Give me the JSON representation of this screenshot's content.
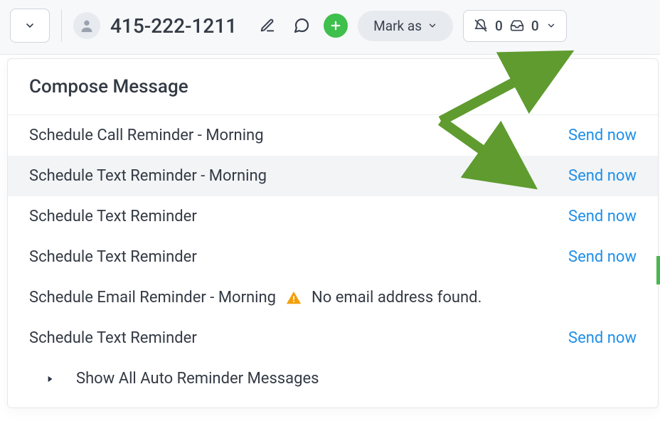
{
  "header": {
    "phone": "415-222-1211",
    "mark_as_label": "Mark as",
    "counter_bell": "0",
    "counter_inbox": "0"
  },
  "panel": {
    "title": "Compose Message",
    "rows": [
      {
        "label": "Schedule Call Reminder - Morning",
        "action": "Send now",
        "highlight": false,
        "warning": null
      },
      {
        "label": "Schedule Text Reminder - Morning",
        "action": "Send now",
        "highlight": true,
        "warning": null
      },
      {
        "label": "Schedule Text Reminder",
        "action": "Send now",
        "highlight": false,
        "warning": null
      },
      {
        "label": "Schedule Text Reminder",
        "action": "Send now",
        "highlight": false,
        "warning": null
      },
      {
        "label": "Schedule Email Reminder - Morning",
        "action": null,
        "highlight": false,
        "warning": "No email address found."
      },
      {
        "label": "Schedule Text Reminder",
        "action": "Send now",
        "highlight": false,
        "warning": null
      }
    ],
    "show_all_label": "Show All Auto Reminder Messages"
  },
  "colors": {
    "link": "#1f8fe8",
    "accent": "#3fbf4c",
    "warning": "#f59e0b",
    "arrow": "#5f9b2f"
  }
}
